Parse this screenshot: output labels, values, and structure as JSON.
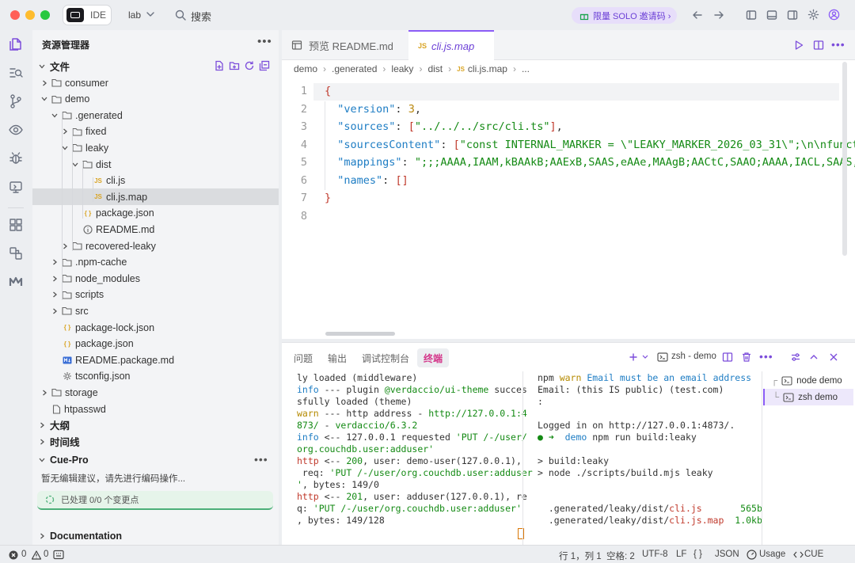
{
  "titlebar": {
    "ide_label": "IDE",
    "project": "lab",
    "search_label": "搜索",
    "promo": "限量 SOLO 邀请码 ›"
  },
  "sidebar": {
    "title": "资源管理器",
    "files_section": "文件",
    "tree": [
      {
        "label": "consumer",
        "kind": "folder",
        "depth": 0,
        "open": false
      },
      {
        "label": "demo",
        "kind": "folder",
        "depth": 0,
        "open": true
      },
      {
        "label": ".generated",
        "kind": "folder",
        "depth": 1,
        "open": true
      },
      {
        "label": "fixed",
        "kind": "folder",
        "depth": 2,
        "open": false
      },
      {
        "label": "leaky",
        "kind": "folder",
        "depth": 2,
        "open": true
      },
      {
        "label": "dist",
        "kind": "folder",
        "depth": 3,
        "open": true
      },
      {
        "label": "cli.js",
        "kind": "js",
        "depth": 4
      },
      {
        "label": "cli.js.map",
        "kind": "js",
        "depth": 4,
        "selected": true
      },
      {
        "label": "package.json",
        "kind": "json",
        "depth": 3
      },
      {
        "label": "README.md",
        "kind": "info",
        "depth": 3
      },
      {
        "label": "recovered-leaky",
        "kind": "folder",
        "depth": 2,
        "open": false
      },
      {
        "label": ".npm-cache",
        "kind": "folder",
        "depth": 1,
        "open": false
      },
      {
        "label": "node_modules",
        "kind": "folder",
        "depth": 1,
        "open": false
      },
      {
        "label": "scripts",
        "kind": "folder",
        "depth": 1,
        "open": false
      },
      {
        "label": "src",
        "kind": "folder",
        "depth": 1,
        "open": false
      },
      {
        "label": "package-lock.json",
        "kind": "json",
        "depth": 1
      },
      {
        "label": "package.json",
        "kind": "json",
        "depth": 1
      },
      {
        "label": "README.package.md",
        "kind": "md",
        "depth": 1
      },
      {
        "label": "tsconfig.json",
        "kind": "gear",
        "depth": 1
      },
      {
        "label": "storage",
        "kind": "folder",
        "depth": 0,
        "open": false
      },
      {
        "label": "htpasswd",
        "kind": "file",
        "depth": 0
      }
    ],
    "outline": "大纲",
    "timeline": "时间线",
    "cue_title": "Cue-Pro",
    "cue_hint": "暂无编辑建议，请先进行编码操作...",
    "cue_status": "已处理 0/0 个变更点",
    "documentation": "Documentation"
  },
  "editor": {
    "tabs": [
      {
        "label": "预览 README.md",
        "active": false
      },
      {
        "label": "cli.js.map",
        "active": true
      }
    ],
    "breadcrumb": [
      "demo",
      "›",
      ".generated",
      "›",
      "leaky",
      "›",
      "dist",
      "›",
      "cli.js.map",
      "›",
      "..."
    ],
    "lines": [
      {
        "n": "1",
        "text": "{"
      },
      {
        "n": "2",
        "key": "\"version\"",
        "val": "3",
        "vt": "num",
        "tail": ","
      },
      {
        "n": "3",
        "key": "\"sources\"",
        "val": "[\"../../../src/cli.ts\"]",
        "vt": "str",
        "tail": ","
      },
      {
        "n": "4",
        "key": "\"sourcesContent\"",
        "val": "[\"const INTERNAL_MARKER = \\\"LEAKY_MARKER_2026_03_31\\\";\\n\\nfunct",
        "vt": "str",
        "tail": ""
      },
      {
        "n": "5",
        "key": "\"mappings\"",
        "val": "\";;;AAAA,IAAM,kBAAkB;AAExB,SAAS,eAAe,MAAgB;AACtC,SAAO;AAAA,IACL,SAAS,",
        "vt": "str",
        "tail": ""
      },
      {
        "n": "6",
        "key": "\"names\"",
        "val": "[]",
        "vt": "str",
        "tail": ""
      },
      {
        "n": "7",
        "text": "}"
      },
      {
        "n": "8",
        "text": ""
      }
    ]
  },
  "panel": {
    "tabs": [
      "问题",
      "输出",
      "调试控制台",
      "终端"
    ],
    "active_tab": "终端",
    "terminal_name": "zsh - demo",
    "left_lines": [
      [
        [
          "p",
          "ly loaded (middleware)"
        ]
      ],
      [
        [
          "c",
          "info"
        ],
        [
          "p",
          " --- plugin "
        ],
        [
          "g",
          "@verdaccio/ui-theme"
        ],
        [
          "p",
          " succes"
        ]
      ],
      [
        [
          "p",
          "sfully loaded (theme)"
        ]
      ],
      [
        [
          "w",
          "warn"
        ],
        [
          "p",
          " --- http address - "
        ],
        [
          "g",
          "http://127.0.0.1:4"
        ]
      ],
      [
        [
          "g",
          "873/"
        ],
        [
          "p",
          " - "
        ],
        [
          "g",
          "verdaccio/6.3.2"
        ]
      ],
      [
        [
          "c",
          "info"
        ],
        [
          "p",
          " <-- 127.0.0.1 requested "
        ],
        [
          "g",
          "'PUT /-/user/"
        ]
      ],
      [
        [
          "g",
          "org.couchdb.user:adduser'"
        ]
      ],
      [
        [
          "r",
          "http"
        ],
        [
          "p",
          " <-- "
        ],
        [
          "g",
          "200"
        ],
        [
          "p",
          ", user: demo-user(127.0.0.1),"
        ]
      ],
      [
        [
          "p",
          " req: "
        ],
        [
          "g",
          "'PUT /-/user/org.couchdb.user:adduser"
        ]
      ],
      [
        [
          "g",
          "'"
        ],
        [
          "p",
          ", bytes: 149/0"
        ]
      ],
      [
        [
          "r",
          "http"
        ],
        [
          "p",
          " <-- "
        ],
        [
          "g",
          "201"
        ],
        [
          "p",
          ", user: adduser(127.0.0.1), re"
        ]
      ],
      [
        [
          "p",
          "q: "
        ],
        [
          "g",
          "'PUT /-/user/org.couchdb.user:adduser'"
        ]
      ],
      [
        [
          "p",
          ", bytes: 149/128"
        ]
      ]
    ],
    "right_lines": [
      [
        [
          "p",
          "npm "
        ],
        [
          "w",
          "warn"
        ],
        [
          "c",
          " Email must be an email address"
        ]
      ],
      [
        [
          "p",
          "Email: (this IS public) (test.com)"
        ]
      ],
      [
        [
          "p",
          ":"
        ]
      ],
      [
        [
          "p",
          ""
        ]
      ],
      [
        [
          "p",
          "Logged in on http://127.0.0.1:4873/."
        ]
      ],
      [
        [
          "g",
          "● ➜ "
        ],
        [
          "c",
          " demo"
        ],
        [
          "p",
          " npm run build:leaky"
        ]
      ],
      [
        [
          "p",
          ""
        ]
      ],
      [
        [
          "p",
          "> build:leaky"
        ]
      ],
      [
        [
          "p",
          "> node ./scripts/build.mjs leaky"
        ]
      ],
      [
        [
          "p",
          ""
        ]
      ],
      [
        [
          "p",
          ""
        ]
      ],
      [
        [
          "p",
          "  .generated/leaky/dist/"
        ],
        [
          "b",
          "cli.js"
        ],
        [
          "g",
          "       565b"
        ]
      ],
      [
        [
          "p",
          "  .generated/leaky/dist/"
        ],
        [
          "b",
          "cli.js.map"
        ],
        [
          "g",
          "  1.0kb"
        ]
      ]
    ],
    "sessions": [
      {
        "label": "node demo",
        "active": false
      },
      {
        "label": "zsh demo",
        "active": true
      }
    ]
  },
  "statusbar": {
    "errors": "0",
    "warnings": "0",
    "position": "行 1，列 1",
    "spaces": "空格: 2",
    "encoding": "UTF-8",
    "eol": "LF",
    "braces": "{ }",
    "language": "JSON",
    "usage": "Usage",
    "cue": "CUE"
  },
  "colors": {
    "accent": "#8b5cf6",
    "terminal_tab": "#d4368a",
    "string": "#148a14",
    "key": "#1e7dc4"
  }
}
